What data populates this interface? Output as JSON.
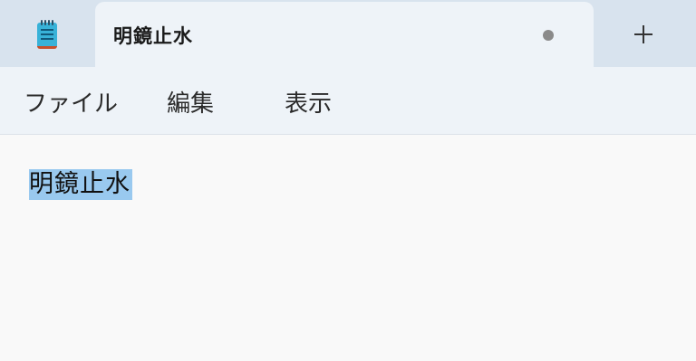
{
  "tab": {
    "title": "明鏡止水",
    "unsaved_indicator": "dot"
  },
  "menu": {
    "items": [
      {
        "label": "ファイル"
      },
      {
        "label": "編集"
      },
      {
        "label": "表示"
      }
    ]
  },
  "editor": {
    "content": "明鏡止水",
    "selected": true,
    "selection_color": "#99c9ef"
  },
  "icons": {
    "app": "notepad-icon",
    "new_tab": "plus-icon"
  },
  "colors": {
    "tabbar_bg": "#d8e3ee",
    "active_tab_bg": "#eef3f8",
    "editor_bg": "#f9f9f9"
  }
}
